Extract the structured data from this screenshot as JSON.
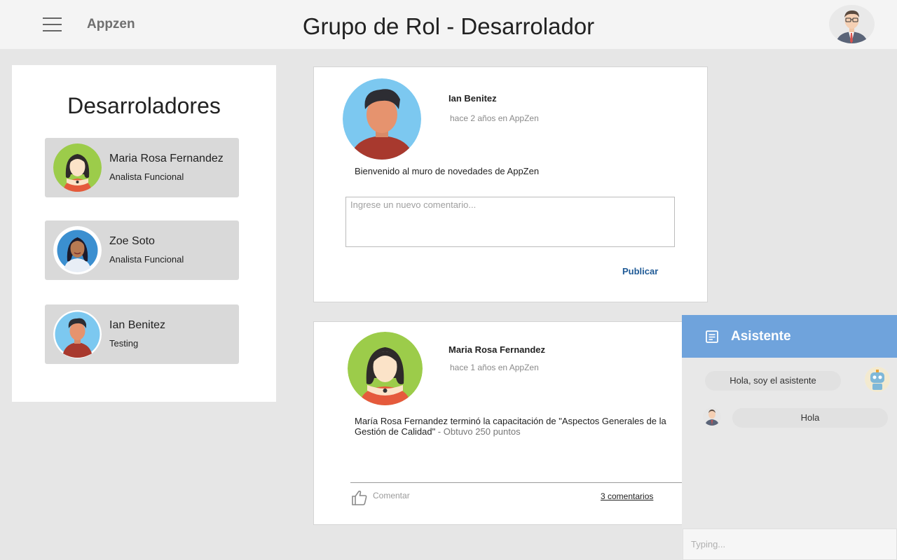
{
  "header": {
    "brand": "Appzen",
    "title": "Grupo de Rol - Desarrolador"
  },
  "sidebar": {
    "title": "Desarroladores",
    "members": [
      {
        "name": "Maria Rosa Fernandez",
        "role": "Analista Funcional"
      },
      {
        "name": "Zoe Soto",
        "role": "Analista Funcional"
      },
      {
        "name": "Ian Benitez",
        "role": "Testing"
      }
    ]
  },
  "posts": [
    {
      "author": "Ian Benitez",
      "time": "hace 2 años en AppZen",
      "text": "Bienvenido al muro de novedades de AppZen",
      "comment_placeholder": "Ingrese un nuevo comentario...",
      "publish_label": "Publicar"
    },
    {
      "author": "Maria Rosa Fernandez",
      "time": "hace 1 años en AppZen",
      "text": "María Rosa Fernandez terminó la capacitación de \"Aspectos Generales de la Gestión de Calidad\"",
      "points_text": " - Obtuvo  250 puntos",
      "comment_label": "Comentar",
      "comments_count": "3 comentarios"
    }
  ],
  "assistant": {
    "title": "Asistente",
    "messages": [
      {
        "from": "bot",
        "text": "Hola, soy el asistente"
      },
      {
        "from": "user",
        "text": "Hola"
      }
    ],
    "input_placeholder": "Typing..."
  },
  "colors": {
    "assistant_header": "#6fa3dc",
    "publish": "#1f5a96",
    "background": "#e6e6e6"
  }
}
